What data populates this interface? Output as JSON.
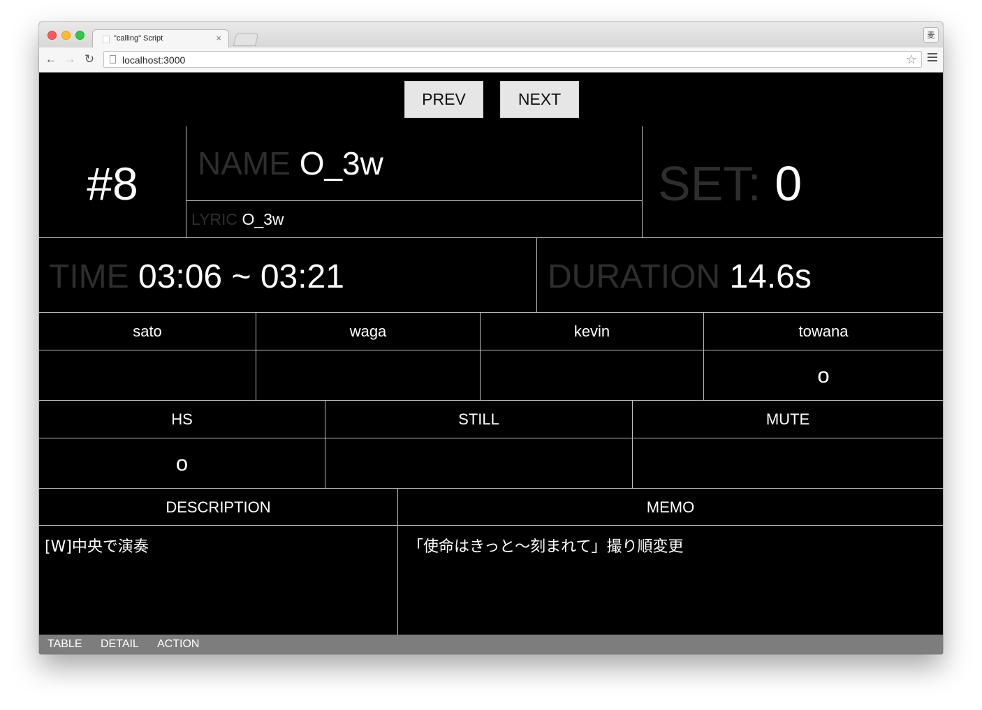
{
  "browser": {
    "tab_title": "\"calling\" Script",
    "tab_close": "×",
    "url": "localhost:3000",
    "profile_label": "麦",
    "back_glyph": "←",
    "forward_glyph": "→",
    "reload_glyph": "↻",
    "star_glyph": "☆"
  },
  "nav": {
    "prev_label": "PREV",
    "next_label": "NEXT"
  },
  "scene": {
    "number": "#8",
    "name_label": "NAME",
    "name_value": "O_3w",
    "lyric_label": "LYRIC",
    "lyric_value": "O_3w",
    "set_label": "SET:",
    "set_value": "0",
    "time_label": "TIME",
    "time_value": "03:06 ~ 03:21",
    "duration_label": "DURATION",
    "duration_value": "14.6s"
  },
  "members": [
    {
      "name": "sato",
      "mark": ""
    },
    {
      "name": "waga",
      "mark": ""
    },
    {
      "name": "kevin",
      "mark": ""
    },
    {
      "name": "towana",
      "mark": "o"
    }
  ],
  "flags": [
    {
      "name": "HS",
      "mark": "o"
    },
    {
      "name": "STILL",
      "mark": ""
    },
    {
      "name": "MUTE",
      "mark": ""
    }
  ],
  "notes": {
    "description_label": "DESCRIPTION",
    "description_value": "[W]中央で演奏",
    "memo_label": "MEMO",
    "memo_value": "「使命はきっと〜刻まれて」撮り順変更"
  },
  "footer": {
    "links": [
      "TABLE",
      "DETAIL",
      "ACTION"
    ]
  },
  "colors": {
    "background": "#000000",
    "text": "#ffffff",
    "dim_label": "#2e2e2e",
    "grid_line": "#bdbdbd",
    "button": "#e6e6e6",
    "footer": "#7d7d7d"
  }
}
